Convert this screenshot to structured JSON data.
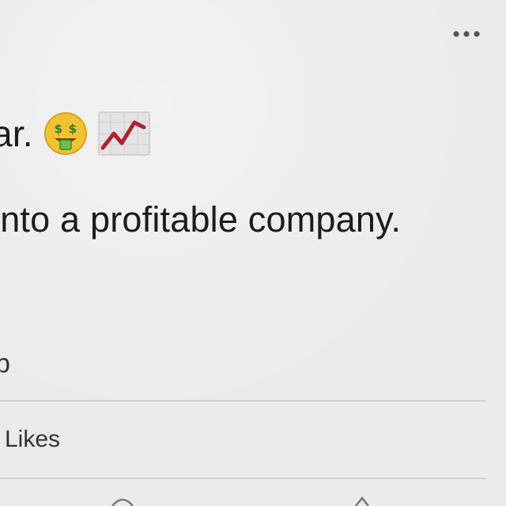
{
  "post": {
    "line1_text": "ar.",
    "line1_emojis": [
      "money-mouth-face-icon",
      "chart-increasing-icon"
    ],
    "line2_text": "into a profitable company."
  },
  "footer": {
    "reaction_fragment": "p",
    "likes_label": "Likes"
  },
  "icons": {
    "more": "more-options-icon"
  },
  "colors": {
    "background": "#ebebeb",
    "text": "#1c1c1c",
    "divider": "#cfcfcf",
    "chart_line": "#b3202e",
    "emoji_face": "#f2c230"
  }
}
